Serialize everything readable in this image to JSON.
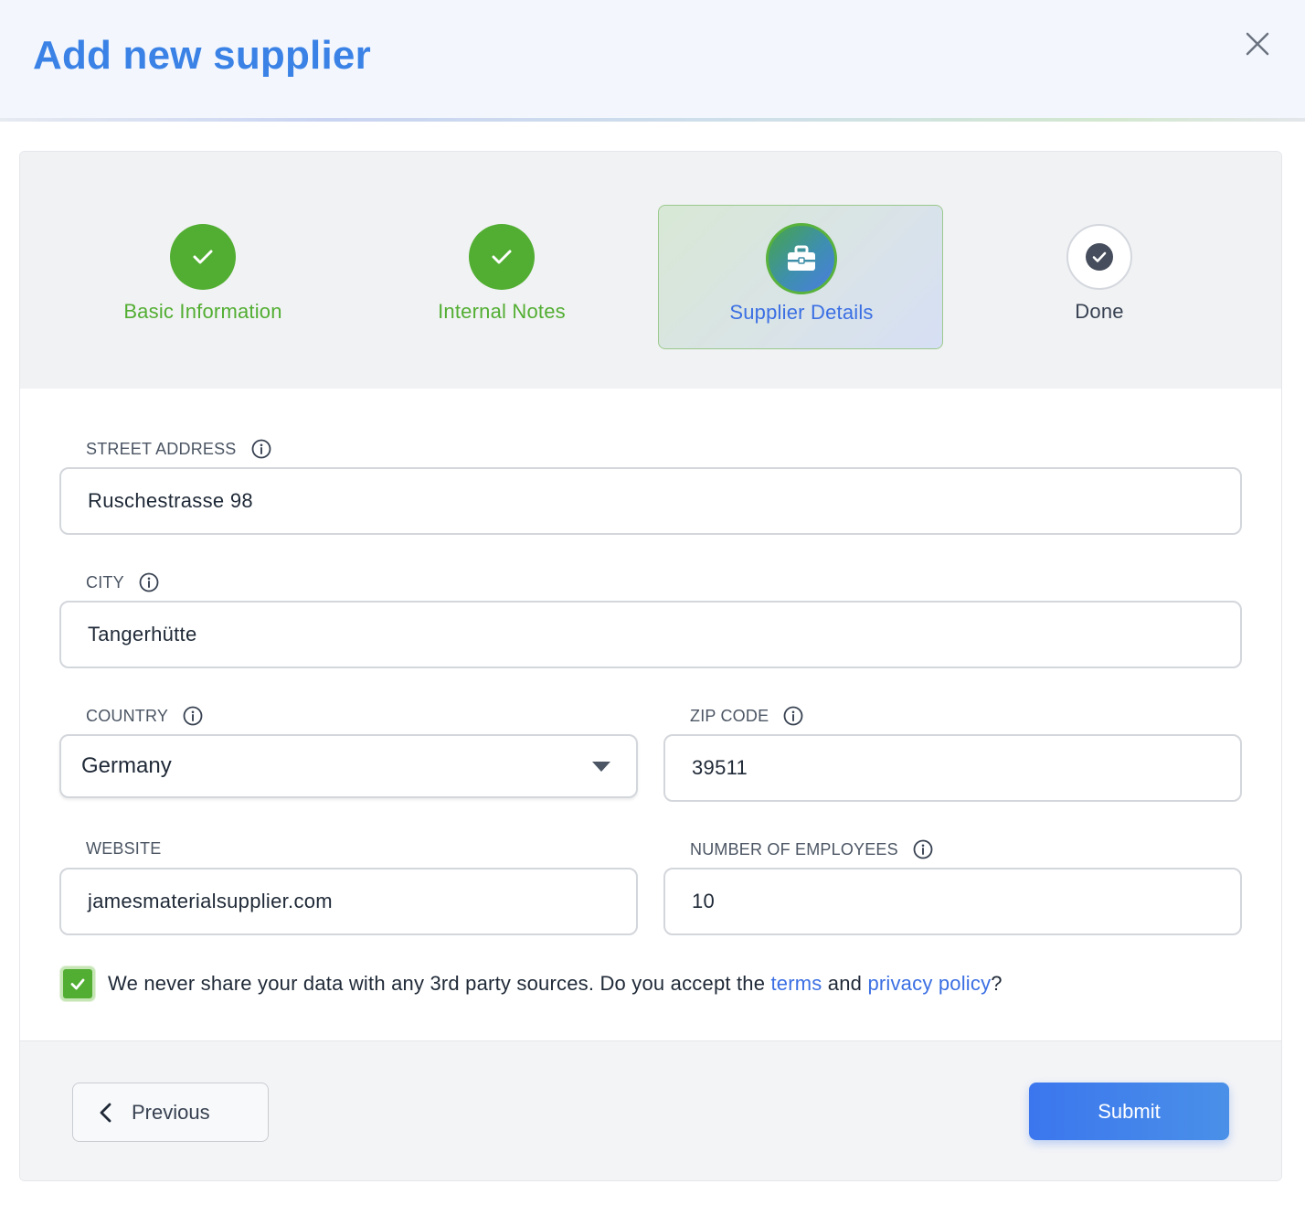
{
  "dialog": {
    "title": "Add new supplier"
  },
  "stepper": {
    "steps": [
      {
        "label": "Basic Information",
        "state": "completed"
      },
      {
        "label": "Internal Notes",
        "state": "completed"
      },
      {
        "label": "Supplier Details",
        "state": "active",
        "icon": "briefcase-icon"
      },
      {
        "label": "Done",
        "state": "pending"
      }
    ]
  },
  "form": {
    "street": {
      "label": "STREET ADDRESS",
      "value": "Ruschestrasse 98"
    },
    "city": {
      "label": "CITY",
      "value": "Tangerhütte"
    },
    "country": {
      "label": "COUNTRY",
      "value": "Germany"
    },
    "zip": {
      "label": "ZIP CODE",
      "value": "39511"
    },
    "website": {
      "label": "WEBSITE",
      "value": "jamesmaterialsupplier.com"
    },
    "employees": {
      "label": "NUMBER OF EMPLOYEES",
      "value": "10"
    }
  },
  "consent": {
    "checked": true,
    "text_before": "We never share your data with any 3rd party sources. Do you accept the ",
    "terms_link": "terms",
    "text_and": " and ",
    "privacy_link": "privacy policy",
    "text_after": "?"
  },
  "actions": {
    "previous_label": "Previous",
    "submit_label": "Submit"
  },
  "colors": {
    "brand_blue": "#3b82e6",
    "success_green": "#52ae32",
    "active_text": "#3b6fe3"
  }
}
